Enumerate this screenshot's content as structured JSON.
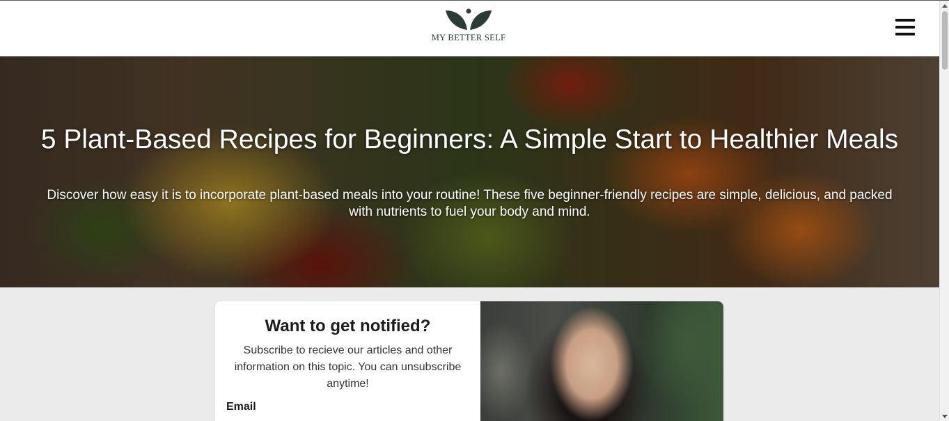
{
  "header": {
    "logo_text": "MY BETTER SELF",
    "logo_icon": "leaves-person-icon",
    "menu_icon": "hamburger-menu-icon"
  },
  "hero": {
    "title": "5 Plant-Based Recipes for Beginners: A Simple Start to Healthier Meals",
    "subtitle": "Discover how easy it is to incorporate plant-based meals into your routine! These five beginner-friendly recipes are simple, delicious, and packed with nutrients to fuel your body and mind."
  },
  "subscribe": {
    "heading": "Want to get notified?",
    "text": "Subscribe to recieve our articles and other information on this topic. You can unsubscribe anytime!",
    "email_label": "Email"
  },
  "colors": {
    "logo_green": "#2b3b36",
    "page_background": "#ebebeb",
    "card_background": "#ffffff"
  }
}
